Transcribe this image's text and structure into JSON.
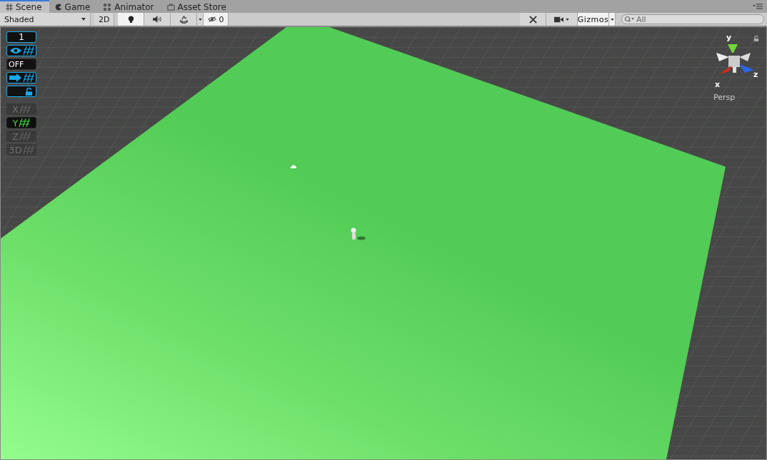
{
  "tabs": [
    {
      "label": "Scene",
      "selected": true
    },
    {
      "label": "Game",
      "selected": false
    },
    {
      "label": "Animator",
      "selected": false
    },
    {
      "label": "Asset Store",
      "selected": false
    }
  ],
  "toolbar": {
    "draw_mode": "Shaded",
    "mode_2d": {
      "label": "2D",
      "on": false
    },
    "lighting_on": true,
    "audio_on": false,
    "effects_on": false,
    "tools_on": false,
    "hidden_count": "0",
    "gizmos": "Gizmos",
    "search": {
      "placeholder": "All"
    }
  },
  "overlay": {
    "snap_value": "1",
    "visibility_on": true,
    "toggle_label": "OFF",
    "move_on": true,
    "lock_on": true,
    "axes": [
      {
        "label": "X",
        "on": false
      },
      {
        "label": "Y",
        "on": true
      },
      {
        "label": "Z",
        "on": false
      },
      {
        "label": "3D",
        "on": false
      }
    ]
  },
  "orientation_gizmo": {
    "y_label": "y",
    "z_label": "z",
    "x_label": "x",
    "projection": "Persp"
  }
}
